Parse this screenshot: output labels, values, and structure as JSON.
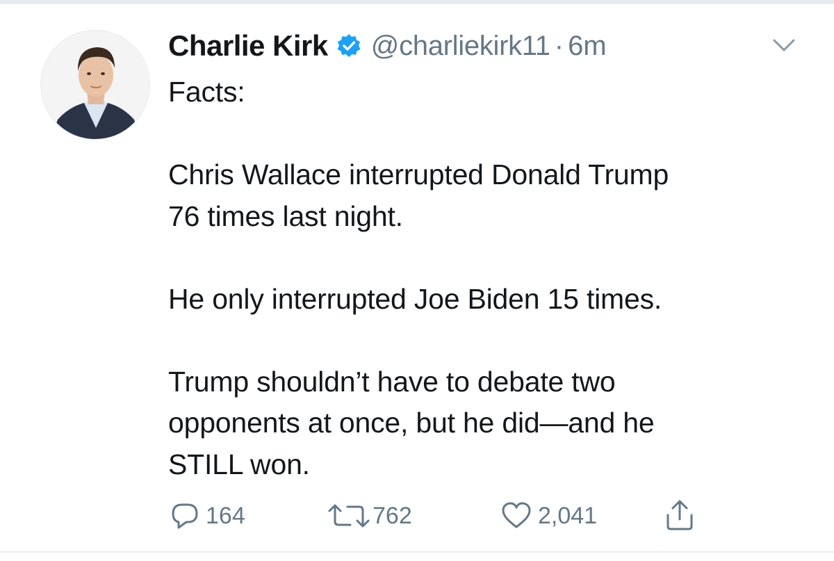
{
  "tweet": {
    "display_name": "Charlie Kirk",
    "handle": "@charliekirk11",
    "separator": "·",
    "time": "6m",
    "verified": true,
    "lines": [
      "Facts:",
      "",
      "Chris Wallace interrupted Donald Trump",
      "76 times last night.",
      "",
      "He only interrupted Joe Biden 15 times.",
      "",
      "Trump shouldn’t have to debate two",
      "opponents at once, but he did—and he",
      "STILL won."
    ]
  },
  "actions": {
    "reply": {
      "icon": "reply-icon",
      "count": "164"
    },
    "retweet": {
      "icon": "retweet-icon",
      "count": "762"
    },
    "like": {
      "icon": "heart-icon",
      "count": "2,041"
    },
    "share": {
      "icon": "share-icon"
    }
  },
  "colors": {
    "text": "#14171a",
    "secondary": "#657786",
    "verified": "#1da1f2",
    "divider": "#e6ecf0"
  }
}
